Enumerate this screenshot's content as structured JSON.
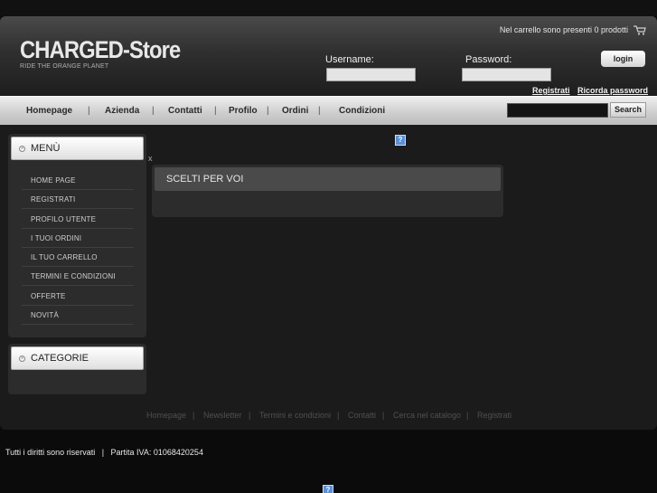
{
  "header": {
    "logo": "CHARGED-Store",
    "tagline": "RIDE THE ORANGE PLANET",
    "cart_text": "Nel carrello sono presenti 0 prodotti",
    "cart_icon": "cart-icon",
    "username_label": "Username:",
    "password_label": "Password:",
    "username_value": "",
    "password_value": "",
    "login_label": "login",
    "register_link": "Registrati",
    "remember_link": "Ricorda password"
  },
  "nav": {
    "items": [
      "Homepage",
      "Azienda",
      "Contatti",
      "Profilo",
      "Ordini",
      "Condizioni"
    ],
    "separator": "|",
    "search_value": "",
    "search_label": "Search"
  },
  "menu": {
    "title": "MENÙ",
    "items": [
      "HOME PAGE",
      "REGISTRATI",
      "PROFILO UTENTE",
      "I TUOI ORDINI",
      "IL TUO CARRELLO",
      "TERMINI E CONDIZIONI",
      "OFFERTE",
      "NOVITÀ"
    ]
  },
  "categories": {
    "title": "CATEGORIE"
  },
  "main": {
    "close_x": "x",
    "help_icon": "?",
    "section_title": "SCELTI PER VOI"
  },
  "footer": {
    "links": [
      "Homepage",
      "Newsletter",
      "Termini e condizioni",
      "Contatti",
      "Cerca nel catalogo",
      "Registrati"
    ],
    "separator": "|",
    "copyright": "Tutti i diritti sono riservati   |   Partita IVA: 01068420254",
    "help_icon": "?"
  },
  "colors": {
    "nav_bg": "#d4d4d4",
    "body_bg": "#1b1b1b",
    "help_blue": "#5b8fd6"
  }
}
